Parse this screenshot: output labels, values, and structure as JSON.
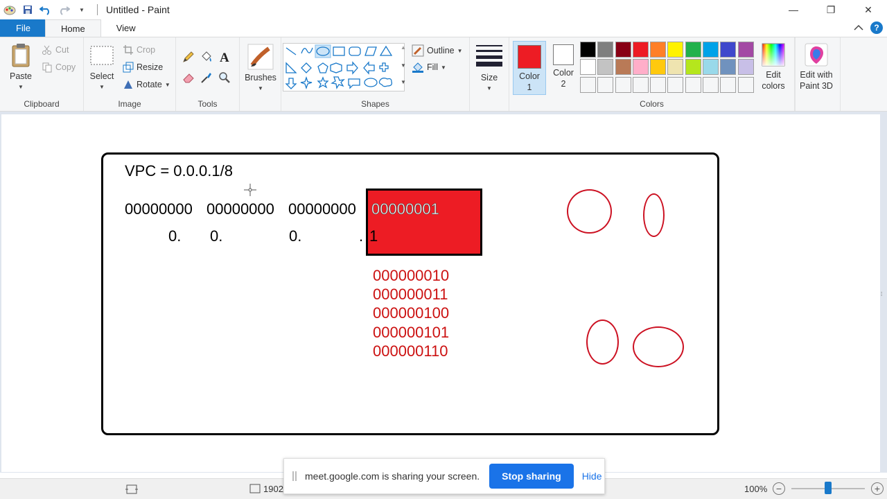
{
  "window": {
    "title": "Untitled - Paint",
    "controls": {
      "minimize": "—",
      "restore": "❐",
      "close": "✕"
    }
  },
  "tabs": [
    {
      "label": "File"
    },
    {
      "label": "Home"
    },
    {
      "label": "View"
    }
  ],
  "ribbon": {
    "clipboard": {
      "label": "Clipboard",
      "paste": "Paste",
      "cut": "Cut",
      "copy": "Copy"
    },
    "image": {
      "label": "Image",
      "select": "Select",
      "crop": "Crop",
      "resize": "Resize",
      "rotate": "Rotate"
    },
    "tools": {
      "label": "Tools"
    },
    "brushes": {
      "label": "Brushes"
    },
    "shapes": {
      "label": "Shapes",
      "outline": "Outline",
      "fill": "Fill"
    },
    "size": {
      "label": "Size"
    },
    "colors": {
      "label": "Colors",
      "color1": "Color\n1",
      "color1_l1": "Color",
      "color1_l2": "1",
      "color2_l1": "Color",
      "color2_l2": "2",
      "color1_value": "#ed1c24",
      "color2_value": "#ffffff",
      "edit_l1": "Edit",
      "edit_l2": "colors",
      "paint3d_l1": "Edit with",
      "paint3d_l2": "Paint 3D",
      "palette_row1": [
        "#000000",
        "#7f7f7f",
        "#880015",
        "#ed1c24",
        "#ff7f27",
        "#fff200",
        "#22b14c",
        "#00a2e8",
        "#3f48cc",
        "#a349a4"
      ],
      "palette_row2": [
        "#ffffff",
        "#c3c3c3",
        "#b97a57",
        "#ffaec9",
        "#ffc90e",
        "#efe4b0",
        "#b5e61d",
        "#99d9ea",
        "#7092be",
        "#c8bfe7"
      ],
      "palette_row3": [
        "#f5f6f7",
        "#f5f6f7",
        "#f5f6f7",
        "#f5f6f7",
        "#f5f6f7",
        "#f5f6f7",
        "#f5f6f7",
        "#f5f6f7",
        "#f5f6f7",
        "#f5f6f7"
      ]
    }
  },
  "canvas": {
    "vpc": "VPC = 0.0.0.1/8",
    "binary": [
      "00000000",
      "00000000",
      "00000000",
      "00000001"
    ],
    "decimal": [
      "0.",
      "0.",
      "0.",
      ".",
      "1"
    ],
    "red_list": [
      "000000010",
      "000000011",
      "000000100",
      "000000101",
      "000000110"
    ]
  },
  "status": {
    "dimension": "1902",
    "zoom": "100%"
  },
  "share_banner": {
    "message": "meet.google.com is sharing your screen.",
    "stop": "Stop sharing",
    "hide": "Hide"
  }
}
